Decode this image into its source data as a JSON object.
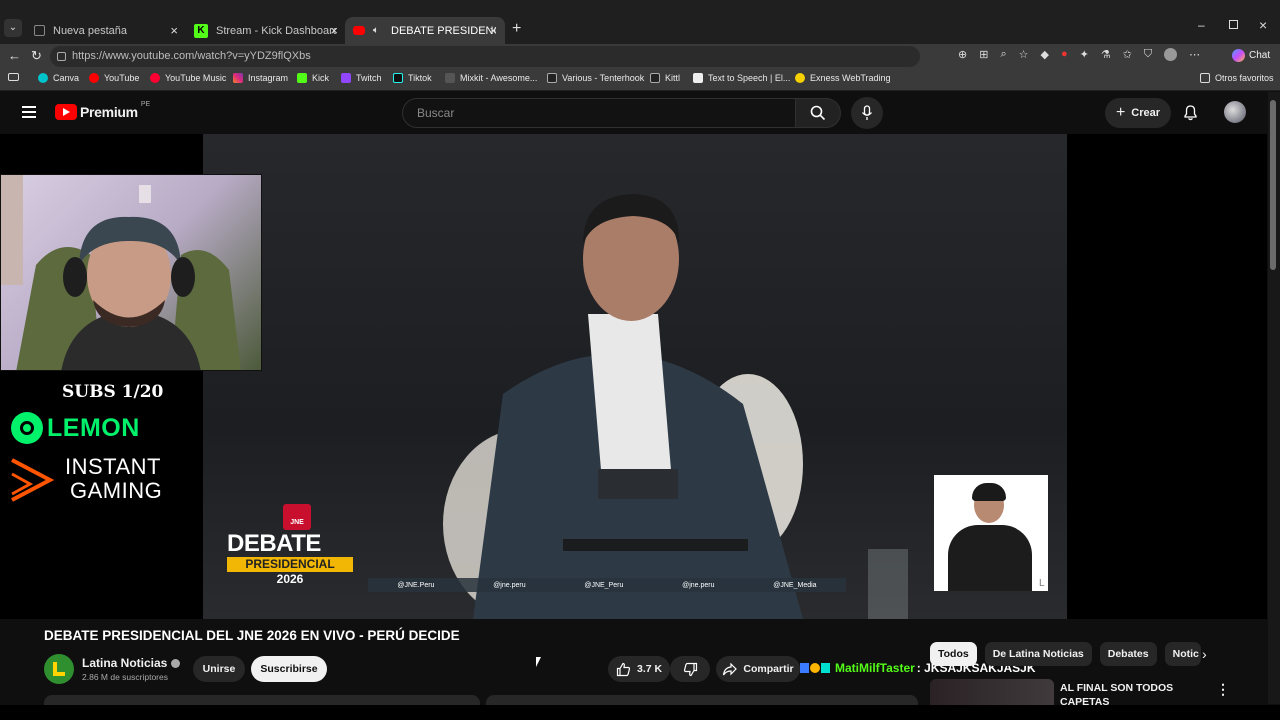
{
  "browser": {
    "tabs": [
      {
        "label": "Nueva pestaña",
        "active": false
      },
      {
        "label": "Stream - Kick Dashboard",
        "active": false
      },
      {
        "label": "DEBATE PRESIDENCIAL DEL JN",
        "active": true
      }
    ],
    "url": "https://www.youtube.com/watch?v=yYDZ9flQXbs",
    "chat_label": "Chat",
    "bookmarks": [
      "Canva",
      "YouTube",
      "YouTube Music",
      "Instagram",
      "Kick",
      "Twitch",
      "Tiktok",
      "Mixkit - Awesome...",
      "Various - Tenterhook",
      "Kittl",
      "Text to Speech | El...",
      "Exness WebTrading"
    ],
    "other_bookmarks": "Otros favoritos"
  },
  "youtube": {
    "logo_text": "Premium",
    "region": "PE",
    "search_placeholder": "Buscar",
    "create_label": "Crear"
  },
  "overlay": {
    "subs": "SUBS 1/20",
    "lemon": "LEMON",
    "instant": "INSTANT",
    "gaming": "GAMING"
  },
  "video": {
    "debate_word": "DEBATE",
    "presidencial_word": "PRESIDENCIAL",
    "year": "2026",
    "jne": "JNE",
    "socials": [
      "@JNE.Peru",
      "@jne.peru",
      "@JNE_Peru",
      "@jne.peru",
      "@JNE_Media"
    ]
  },
  "watch": {
    "title": "DEBATE PRESIDENCIAL DEL JNE 2026 EN VIVO - PERÚ DECIDE",
    "channel": "Latina Noticias",
    "subscribers": "2.86 M de suscriptores",
    "join_label": "Unirse",
    "subscribe_label": "Suscribirse",
    "likes": "3.7 K",
    "share_label": "Compartir",
    "chat_user": "MatiMilfTaster",
    "chat_msg": ": JKSAJKSAKJASJK",
    "chips": [
      "Todos",
      "De Latina Noticias",
      "Debates",
      "Notic"
    ],
    "related_title_1": "AL FINAL SON TODOS",
    "related_title_2": "CAPETAS"
  }
}
